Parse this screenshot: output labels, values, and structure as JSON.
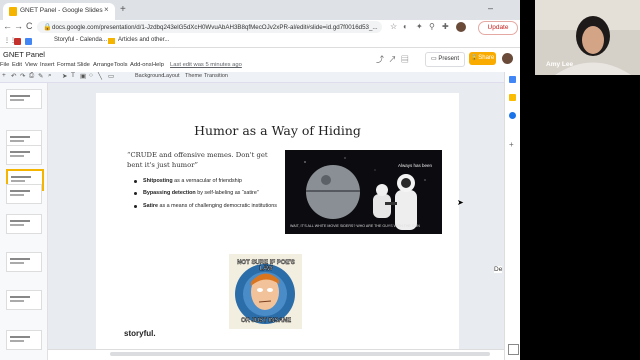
{
  "browser": {
    "tab_title": "GNET Panel - Google Slides",
    "tab_close": "×",
    "new_tab": "+",
    "url": "docs.google.com/presentation/d/1-Jzdbq243elG5dXcH0WvuAbAH3B8qfMecOJv2xPR-al/edit#slide=id.gd7f0016d53_...",
    "update_label": "Update",
    "minimize": "–",
    "back": "←",
    "forward": "→",
    "reload": "C",
    "bookmarks": [
      {
        "label": "Apps"
      },
      {
        "label": "Storyful - Calenda..."
      },
      {
        "label": "Articles and other..."
      }
    ]
  },
  "slides_app": {
    "doc_title": "GNET Panel",
    "menus": [
      "File",
      "Edit",
      "View",
      "Insert",
      "Format",
      "Slide",
      "Arrange",
      "Tools",
      "Add-ons",
      "Help"
    ],
    "last_edit": "Last edit was 5 minutes ago",
    "present_label": "Present",
    "share_label": "Share",
    "toolbar_items": [
      "Background",
      "Layout",
      "Theme",
      "Transition"
    ]
  },
  "slide": {
    "title": "Humor as a Way of Hiding",
    "quote": "“CRUDE and offensive memes. Don't get bent it's just humor”",
    "bullets": [
      {
        "bold": "Shitposting",
        "rest": " as a vernacular of friendship"
      },
      {
        "bold": "Bypassing detection",
        "rest": " by self-labeling as “satire”"
      },
      {
        "bold": "Satire",
        "rest": " as a means of challenging democratic institutions"
      }
    ],
    "image1_label": "Always has been",
    "image1_caption": "WAIT, IT'S ALL WHITE MOVIE SIDERS? WHO ARE THE GUYS WITH THE GUN",
    "image2_top": "NOT SURE IF POE'S LAW",
    "image2_bottom": "OR JUST INSANE",
    "footer_logo": "storyful."
  },
  "side_text": "De",
  "video": {
    "participant_name": "Amy Lee"
  },
  "colors": {
    "accent": "#f4b400",
    "update_red": "#c5221f",
    "share_yellow": "#f9ab00"
  }
}
